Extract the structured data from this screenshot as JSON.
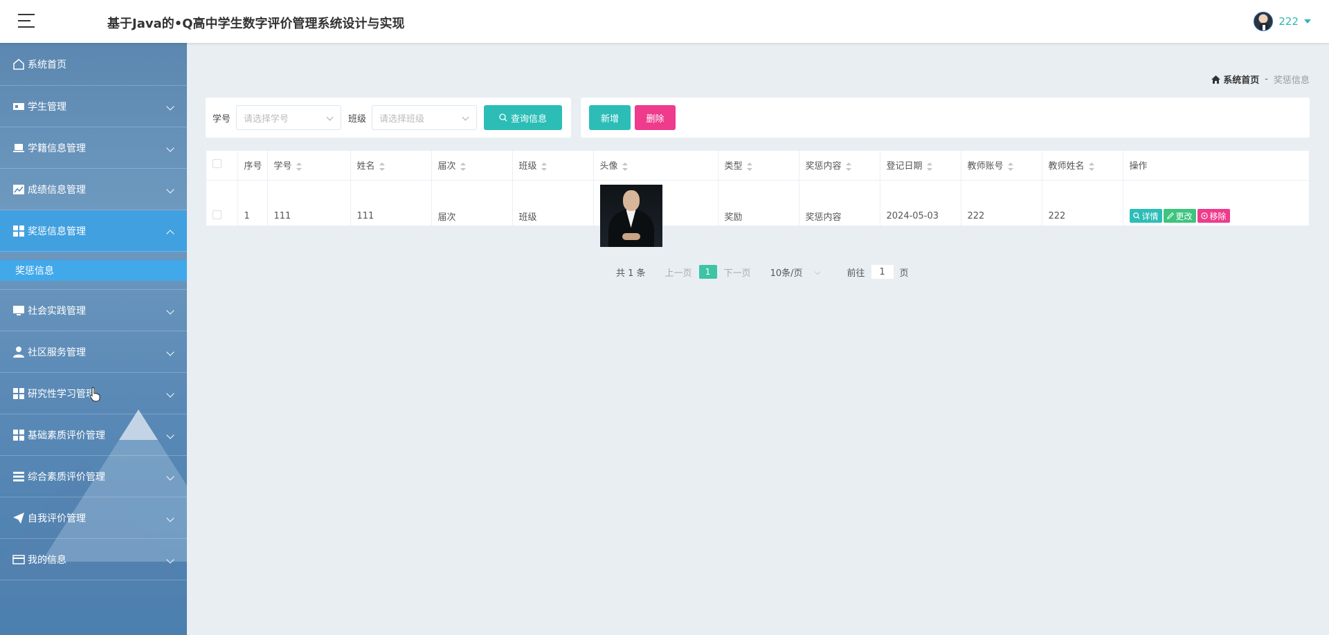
{
  "header": {
    "title": "基于Java的•Q高中学生数字评价管理系统设计与实现",
    "username": "222"
  },
  "sidebar": {
    "items": [
      {
        "label": "系统首页",
        "icon": "home-icon"
      },
      {
        "label": "学生管理",
        "icon": "id-card-icon"
      },
      {
        "label": "学籍信息管理",
        "icon": "laptop-icon"
      },
      {
        "label": "成绩信息管理",
        "icon": "chart-icon"
      },
      {
        "label": "奖惩信息管理",
        "icon": "grid-icon",
        "open": true
      },
      {
        "label": "社会实践管理",
        "icon": "monitor-icon"
      },
      {
        "label": "社区服务管理",
        "icon": "user-icon"
      },
      {
        "label": "研究性学习管理",
        "icon": "grid-icon"
      },
      {
        "label": "基础素质评价管理",
        "icon": "grid-icon"
      },
      {
        "label": "综合素质评价管理",
        "icon": "list-icon"
      },
      {
        "label": "自我评价管理",
        "icon": "send-icon"
      },
      {
        "label": "我的信息",
        "icon": "wallet-icon"
      }
    ],
    "submenu": {
      "label": "奖惩信息"
    }
  },
  "breadcrumb": {
    "home": "系统首页",
    "separator": "-",
    "current": "奖惩信息"
  },
  "search": {
    "student_no_label": "学号",
    "student_no_placeholder": "请选择学号",
    "class_label": "班级",
    "class_placeholder": "请选择班级",
    "query_button": "查询信息"
  },
  "actions": {
    "add_button": "新增",
    "delete_button": "删除"
  },
  "table": {
    "columns": [
      "序号",
      "学号",
      "姓名",
      "届次",
      "班级",
      "头像",
      "类型",
      "奖惩内容",
      "登记日期",
      "教师账号",
      "教师姓名",
      "操作"
    ],
    "rows": [
      {
        "index": "1",
        "student_no": "111",
        "name": "111",
        "session": "届次",
        "class": "班级",
        "type": "奖励",
        "content": "奖惩内容",
        "date": "2024-05-03",
        "teacher_account": "222",
        "teacher_name": "222"
      }
    ],
    "row_actions": {
      "detail": "详情",
      "edit": "更改",
      "remove": "移除"
    }
  },
  "pagination": {
    "total": "共 1 条",
    "prev": "上一页",
    "current_page": "1",
    "next": "下一页",
    "page_size": "10条/页",
    "goto_label": "前往",
    "goto_value": "1",
    "page_unit": "页"
  },
  "colors": {
    "accent_teal": "#2cbdb7",
    "accent_pink": "#ee3b8c",
    "accent_green": "#3dc47e",
    "sidebar_active": "#41a0e0"
  }
}
